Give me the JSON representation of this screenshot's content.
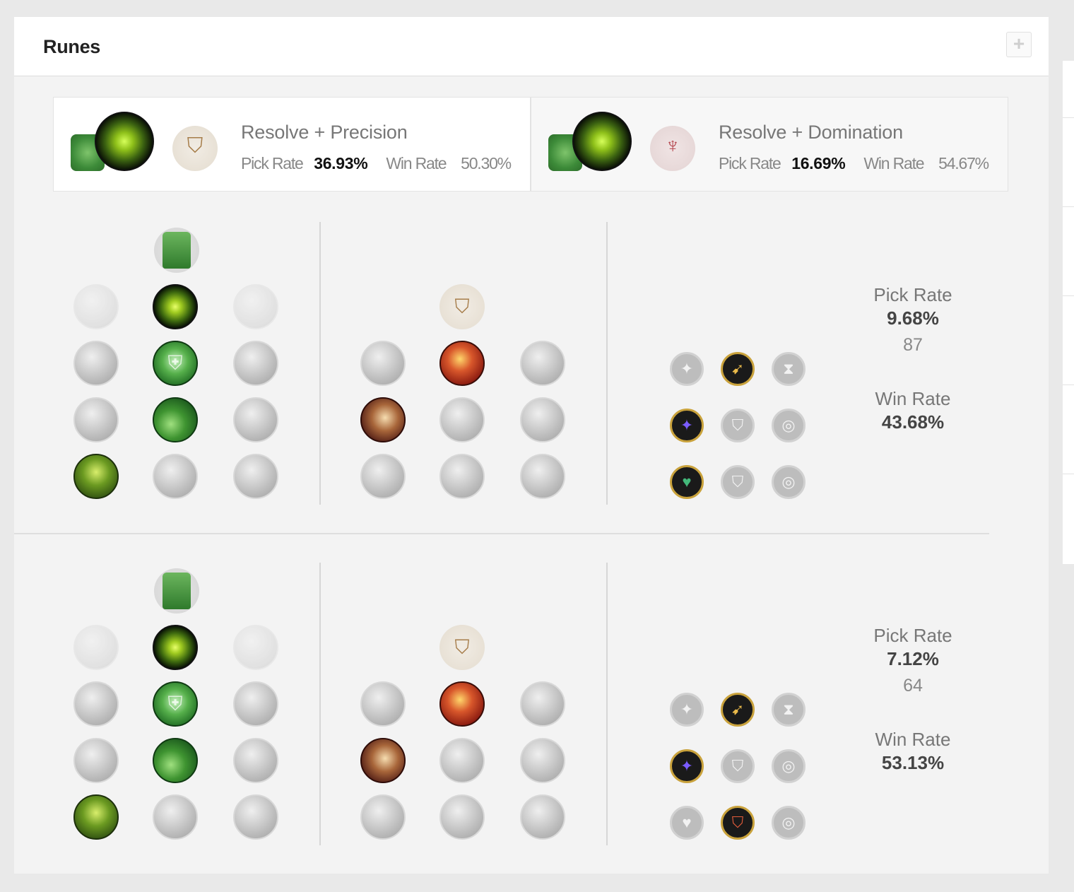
{
  "panel": {
    "title": "Runes",
    "expand_icon": "plus-icon"
  },
  "combos": [
    {
      "title": "Resolve + Precision",
      "pick_label": "Pick Rate",
      "pick_value": "36.93%",
      "win_label": "Win Rate",
      "win_value": "50.30%"
    },
    {
      "title": "Resolve + Domination",
      "pick_label": "Pick Rate",
      "pick_value": "16.69%",
      "win_label": "Win Rate",
      "win_value": "54.67%"
    }
  ],
  "builds": [
    {
      "pick_label": "Pick Rate",
      "pick_value": "9.68%",
      "games": "87",
      "win_label": "Win Rate",
      "win_value": "43.68%",
      "shards": [
        [
          "adaptive-force-icon",
          "attack-speed-icon",
          "ability-haste-icon"
        ],
        [
          "adaptive-force-icon",
          "armor-icon",
          "magic-resist-icon"
        ],
        [
          "health-scaling-icon",
          "armor-icon",
          "magic-resist-icon"
        ]
      ],
      "shards_selected": [
        1,
        0,
        0
      ]
    },
    {
      "pick_label": "Pick Rate",
      "pick_value": "7.12%",
      "games": "64",
      "win_label": "Win Rate",
      "win_value": "53.13%",
      "shards": [
        [
          "adaptive-force-icon",
          "attack-speed-icon",
          "ability-haste-icon"
        ],
        [
          "adaptive-force-icon",
          "armor-icon",
          "magic-resist-icon"
        ],
        [
          "health-scaling-icon",
          "armor-icon",
          "magic-resist-icon"
        ]
      ],
      "shards_selected": [
        1,
        0,
        1
      ]
    }
  ]
}
